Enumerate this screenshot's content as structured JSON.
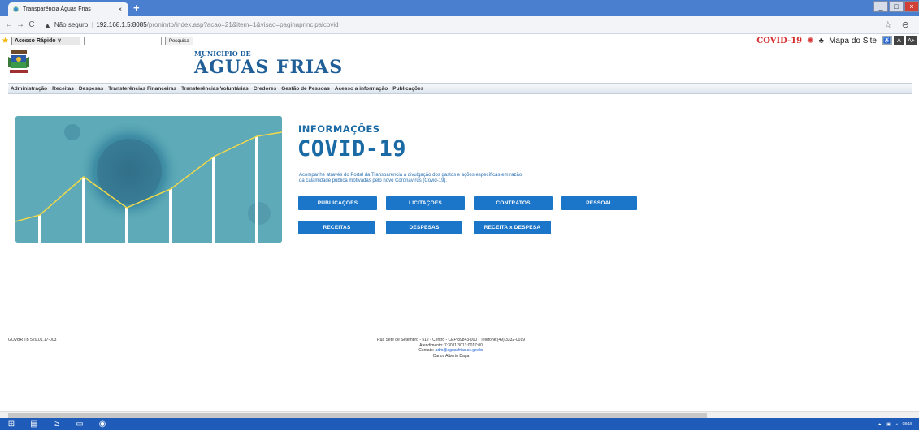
{
  "browser": {
    "tab_title": "Transparência Águas Frias",
    "tab_close": "×",
    "new_tab": "+",
    "nav_back": "←",
    "nav_forward": "→",
    "nav_reload": "C",
    "security_warning": "Não seguro",
    "url_host": "192.168.1.5:8085",
    "url_path": "/pronimtb/index.asp?acao=21&item=1&visao=paginaprincipalcovid",
    "bookmark_icon": "☆",
    "profile_icon": "⊖",
    "win_min": "_",
    "win_max": "□",
    "win_close": "×"
  },
  "toolbar": {
    "quick_access": "Acesso Rápido ∨",
    "search_button": "Pesquisa",
    "covid_link": "COVID-19",
    "site_map": "Mapa do Site",
    "acc_a": "A",
    "acc_aplus": "A+"
  },
  "header": {
    "municipio": "MUNICÍPIO DE",
    "city": "ÁGUAS FRIAS"
  },
  "menu": [
    "Administração",
    "Receitas",
    "Despesas",
    "Transferências Financeiras",
    "Transferências Voluntárias",
    "Credores",
    "Gestão de Pessoas",
    "Acesso a informação",
    "Publicações"
  ],
  "main": {
    "title": "INFORMAÇÕES",
    "subtitle": "COVID-19",
    "description_line1": "Acompanhe através do Portal da Transparência a divulgação dos gastos e ações específicas em razão",
    "description_line2": "da calamidade pública motivadas pelo novo Coronavírus (Covid-19).",
    "buttons_row1": [
      "PUBLICAÇÕES",
      "LICITAÇÕES",
      "CONTRATOS",
      "PESSOAL"
    ],
    "buttons_row2": [
      "RECEITAS",
      "DESPESAS",
      "RECEITA x DESPESA"
    ]
  },
  "footer": {
    "version": "GOVBR TB 520.01.17-003",
    "address": "Rua Sete de Setembro - 512 - Centro - CEP:89843-000 - Telefone:(49) 3332-0019",
    "hours": "Atendimento: 7:3011:3013:0017:00",
    "contact_label": "Contato:",
    "contact_email": "adm@aguasfrias.sc.gov.br",
    "name": "Carlos Alberto Daga"
  },
  "taskbar": {
    "time": "08:15",
    "tray_arrow": "▲"
  }
}
